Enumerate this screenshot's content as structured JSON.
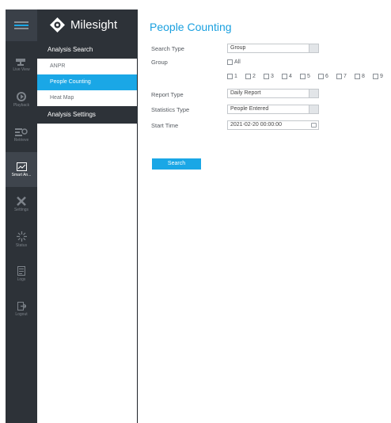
{
  "brand": {
    "name": "Milesight"
  },
  "rail": {
    "items": [
      {
        "label": "Live View",
        "icon": "camera-icon"
      },
      {
        "label": "Playback",
        "icon": "playback-icon"
      },
      {
        "label": "Retrieve",
        "icon": "retrieve-icon"
      },
      {
        "label": "Smart An...",
        "icon": "smart-analysis-icon"
      },
      {
        "label": "Settings",
        "icon": "wrench-icon"
      },
      {
        "label": "Status",
        "icon": "status-icon"
      },
      {
        "label": "Logs",
        "icon": "logs-icon"
      },
      {
        "label": "Logout",
        "icon": "logout-icon"
      }
    ]
  },
  "menu": {
    "analysis_search": "Analysis Search",
    "sub_items": [
      "ANPR",
      "People Counting",
      "Heat Map"
    ],
    "analysis_settings": "Analysis Settings"
  },
  "main": {
    "title": "People Counting",
    "search_type": {
      "label": "Search Type",
      "value": "Group"
    },
    "group": {
      "label": "Group",
      "all": "All",
      "numbers": [
        "1",
        "2",
        "3",
        "4",
        "5",
        "6",
        "7",
        "8",
        "9"
      ]
    },
    "report_type": {
      "label": "Report Type",
      "value": "Daily Report"
    },
    "statistics_type": {
      "label": "Statistics Type",
      "value": "People Entered"
    },
    "start_time": {
      "label": "Start Time",
      "value": "2021-02-20 00:00:00"
    },
    "search_button": "Search"
  },
  "colors": {
    "accent": "#1aa7e6",
    "sidebar": "#2d3238"
  }
}
